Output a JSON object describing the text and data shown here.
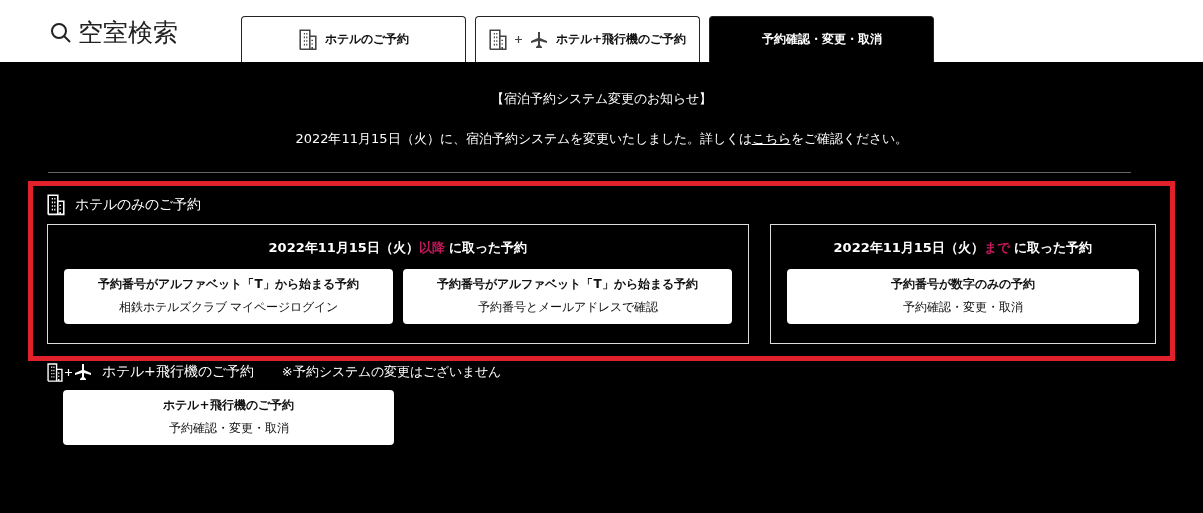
{
  "header": {
    "title": "空室検索"
  },
  "tabs": [
    {
      "label": "ホテルのご予約",
      "kind": "hotel",
      "selected": false
    },
    {
      "label": "ホテル+飛行機のご予約",
      "kind": "combo",
      "selected": false
    },
    {
      "label": "予約確認・変更・取消",
      "kind": "plain",
      "selected": true
    }
  ],
  "notice": {
    "title": "【宿泊予約システム変更のお知らせ】",
    "before": "2022年11月15日（火）に、宿泊予約システムを変更いたしました。詳しくは",
    "link": "こちら",
    "after": "をご確認ください。"
  },
  "hotel_only": {
    "title": "ホテルのみのご予約",
    "highlighted": true,
    "groups": [
      {
        "date": "2022年11月15日（火）",
        "emphasis": "以降",
        "rest": "に取った予約",
        "buttons": [
          {
            "title": "予約番号がアルファベット「T」から始まる予約",
            "subtitle": "相鉄ホテルズクラブ マイページログイン"
          },
          {
            "title": "予約番号がアルファベット「T」から始まる予約",
            "subtitle": "予約番号とメールアドレスで確認"
          }
        ]
      },
      {
        "date": "2022年11月15日（火）",
        "emphasis": "まで",
        "rest": "に取った予約",
        "buttons": [
          {
            "title": "予約番号が数字のみの予約",
            "subtitle": "予約確認・変更・取消"
          }
        ]
      }
    ]
  },
  "hotel_plane": {
    "title": "ホテル+飛行機のご予約",
    "note": "※予約システムの変更はございません",
    "buttons": [
      {
        "title": "ホテル+飛行機のご予約",
        "subtitle": "予約確認・変更・取消"
      }
    ]
  }
}
